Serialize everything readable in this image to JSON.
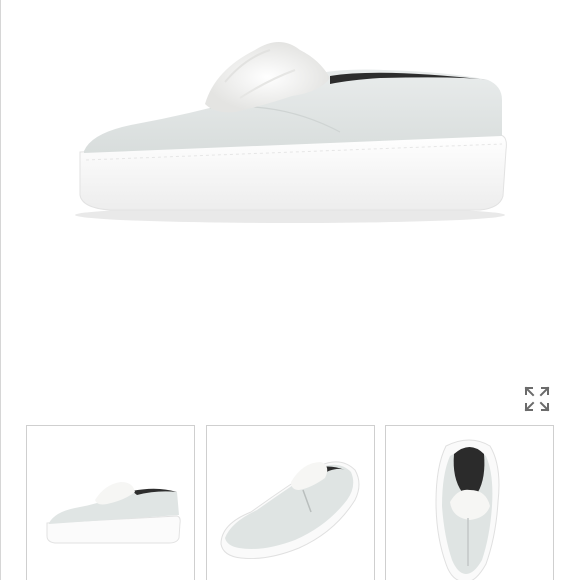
{
  "gallery": {
    "main_image": {
      "icon": "slip-on-sneaker-side-view",
      "alt": ""
    },
    "expand_control": {
      "icon": "expand-arrows-icon"
    },
    "thumbnails": [
      {
        "icon": "sneaker-side-view-thumbnail"
      },
      {
        "icon": "sneaker-front-angle-thumbnail"
      },
      {
        "icon": "sneaker-top-view-thumbnail"
      }
    ]
  },
  "colors": {
    "suede": "#e1e5e4",
    "sole": "#ffffff",
    "fur": "#f4f4f2",
    "border": "#cfcfcf",
    "icon": "#6b6b6b"
  }
}
